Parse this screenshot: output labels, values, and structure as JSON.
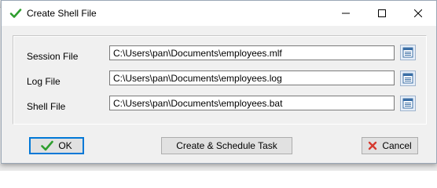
{
  "window": {
    "title": "Create Shell File"
  },
  "fields": [
    {
      "label": "Session File",
      "value": "C:\\Users\\pan\\Documents\\employees.mlf"
    },
    {
      "label": "Log File",
      "value": "C:\\Users\\pan\\Documents\\employees.log"
    },
    {
      "label": "Shell File",
      "value": "C:\\Users\\pan\\Documents\\employees.bat"
    }
  ],
  "buttons": {
    "ok": "OK",
    "schedule": "Create & Schedule Task",
    "cancel": "Cancel"
  },
  "colors": {
    "accent": "#0078d7",
    "check": "#2e9e2e",
    "cancel_x": "#d63a2f"
  }
}
